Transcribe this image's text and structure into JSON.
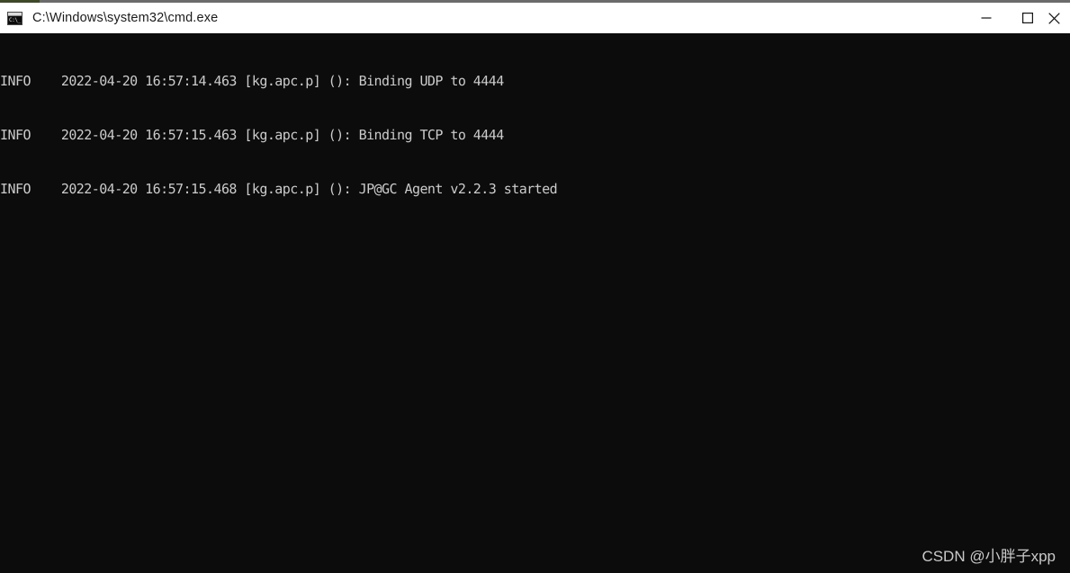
{
  "window": {
    "title": "C:\\Windows\\system32\\cmd.exe",
    "icon_name": "cmd-console-icon",
    "icon_glyph": "C:\\_",
    "titlebar_bg": "#ffffff",
    "titlebar_fg": "#1b1b1b",
    "top_border_color": "#6b6b6b",
    "top_border_accent_color": "#3e4a27",
    "controls": [
      {
        "name": "minimize",
        "label": "Minimize",
        "glyph": "—"
      },
      {
        "name": "maximize",
        "label": "Maximize",
        "glyph": "□"
      },
      {
        "name": "close",
        "label": "Close",
        "glyph": "✕"
      }
    ]
  },
  "terminal": {
    "background": "#0c0c0c",
    "foreground": "#cccccc",
    "lines": [
      "INFO    2022-04-20 16:57:14.463 [kg.apc.p] (): Binding UDP to 4444",
      "INFO    2022-04-20 16:57:15.463 [kg.apc.p] (): Binding TCP to 4444",
      "INFO    2022-04-20 16:57:15.468 [kg.apc.p] (): JP@GC Agent v2.2.3 started"
    ],
    "entries": [
      {
        "level": "INFO",
        "date": "2022-04-20",
        "time": "16:57:14.463",
        "logger": "[kg.apc.p]",
        "method": "():",
        "message": "Binding UDP to 4444"
      },
      {
        "level": "INFO",
        "date": "2022-04-20",
        "time": "16:57:15.463",
        "logger": "[kg.apc.p]",
        "method": "():",
        "message": "Binding TCP to 4444"
      },
      {
        "level": "INFO",
        "date": "2022-04-20",
        "time": "16:57:15.468",
        "logger": "[kg.apc.p]",
        "method": "():",
        "message": "JP@GC Agent v2.2.3 started"
      }
    ]
  },
  "watermark": {
    "text": "CSDN @小胖子xpp",
    "color": "#c9c9c9"
  }
}
